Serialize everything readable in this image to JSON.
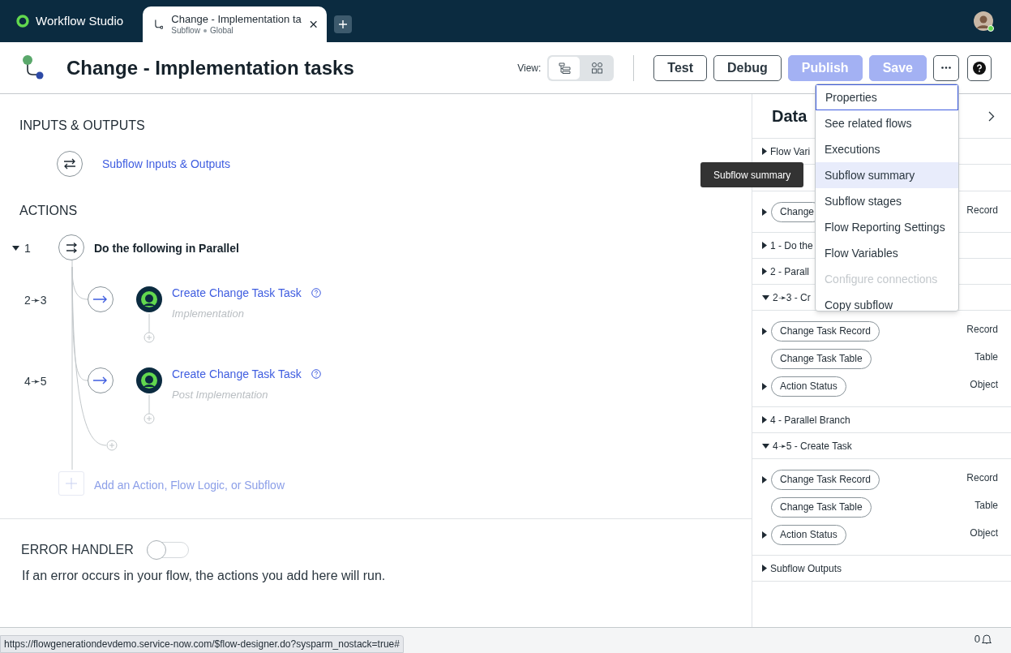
{
  "app": {
    "name": "Workflow Studio"
  },
  "tabs": [
    {
      "title": "Change - Implementation ta",
      "type": "Subflow",
      "scope": "Global",
      "selected": true
    }
  ],
  "header": {
    "title": "Change - Implementation tasks",
    "view_label": "View:",
    "view_modes": [
      {
        "kind": "list",
        "selected": true
      },
      {
        "kind": "diagram",
        "selected": false
      }
    ],
    "buttons": [
      {
        "label": "Test",
        "disabled": false
      },
      {
        "label": "Debug",
        "disabled": false
      },
      {
        "label": "Publish",
        "disabled": true
      },
      {
        "label": "Save",
        "disabled": true
      }
    ]
  },
  "inputs_outputs": {
    "heading": "INPUTS & OUTPUTS",
    "link": "Subflow Inputs & Outputs"
  },
  "actions": {
    "heading": "ACTIONS",
    "add_label": "Add an Action, Flow Logic, or Subflow",
    "items": [
      {
        "number": "1",
        "label": "Do the following in Parallel",
        "expanded": true,
        "children": [
          {
            "number": "2➛3",
            "label": "Create Change Task Task",
            "annotation": "Implementation"
          },
          {
            "number": "4➛5",
            "label": "Create Change Task Task",
            "annotation": "Post Implementation"
          }
        ]
      }
    ]
  },
  "error_handler": {
    "heading": "ERROR HANDLER",
    "on": false,
    "description": "If an error occurs in your flow, the actions you add here will run."
  },
  "data_panel": {
    "title": "Data",
    "sections": [
      {
        "label": "Flow Vari",
        "expanded": false
      },
      {
        "children": [
          {
            "label": "Change",
            "type": "Record",
            "expandable": true
          }
        ]
      },
      {
        "label": "1 - Do the",
        "expanded": false
      },
      {
        "label": "2 - Parall",
        "expanded": false
      },
      {
        "label": "2➛3 - Cr",
        "expanded": true,
        "children": [
          {
            "label": "Change Task Record",
            "type": "Record",
            "expandable": true
          },
          {
            "label": "Change Task Table",
            "type": "Table",
            "expandable": false
          },
          {
            "label": "Action Status",
            "type": "Object",
            "expandable": true
          }
        ]
      },
      {
        "label": "4 - Parallel Branch",
        "expanded": false
      },
      {
        "label": "4➛5 - Create Task",
        "expanded": true,
        "children": [
          {
            "label": "Change Task Record",
            "type": "Record",
            "expandable": true
          },
          {
            "label": "Change Task Table",
            "type": "Table",
            "expandable": false
          },
          {
            "label": "Action Status",
            "type": "Object",
            "expandable": true
          }
        ]
      },
      {
        "label": "Subflow Outputs",
        "expanded": false
      }
    ]
  },
  "menu": {
    "items": [
      {
        "label": "Properties",
        "focused": true,
        "highlighted": false,
        "disabled": false
      },
      {
        "label": "See related flows",
        "focused": false,
        "highlighted": false,
        "disabled": false
      },
      {
        "label": "Executions",
        "focused": false,
        "highlighted": false,
        "disabled": false
      },
      {
        "label": "Subflow summary",
        "focused": false,
        "highlighted": true,
        "disabled": false
      },
      {
        "label": "Subflow stages",
        "focused": false,
        "highlighted": false,
        "disabled": false
      },
      {
        "label": "Flow Reporting Settings",
        "focused": false,
        "highlighted": false,
        "disabled": false
      },
      {
        "label": "Flow Variables",
        "focused": false,
        "highlighted": false,
        "disabled": false
      },
      {
        "label": "Configure connections",
        "focused": false,
        "highlighted": false,
        "disabled": true
      },
      {
        "label": "Copy subflow",
        "focused": false,
        "highlighted": false,
        "disabled": false
      }
    ]
  },
  "tooltip": {
    "text": "Subflow summary"
  },
  "status_bar": {
    "url": "https://flowgenerationdevdemo.service-now.com/$flow-designer.do?sysparm_nostack=true#",
    "notifications": "0"
  }
}
